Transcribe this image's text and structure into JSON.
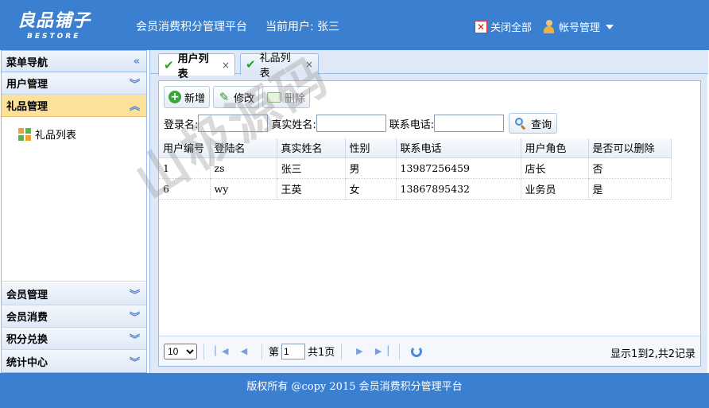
{
  "header": {
    "logo_cn": "良品铺子",
    "logo_en": "BESTORE",
    "title": "会员消费积分管理平台",
    "current_user": "当前用户: 张三",
    "close_all_label": "关闭全部",
    "account_label": "帐号管理"
  },
  "sidebar": {
    "title": "菜单导航",
    "top_sections": [
      "用户管理",
      "礼品管理"
    ],
    "active_section": "礼品管理",
    "active_items": [
      "礼品列表"
    ],
    "bottom_sections": [
      "会员管理",
      "会员消费",
      "积分兑换",
      "统计中心"
    ]
  },
  "tabs": [
    {
      "label": "用户列表",
      "active": true
    },
    {
      "label": "礼品列表",
      "active": false
    }
  ],
  "toolbar": {
    "add_label": "新增",
    "edit_label": "修改",
    "delete_label": "删除"
  },
  "search": {
    "login_label": "登录名:",
    "realname_label": "真实姓名:",
    "phone_label": "联系电话:",
    "query_label": "查询",
    "login_value": "",
    "realname_value": "",
    "phone_value": ""
  },
  "grid": {
    "columns": [
      "用户编号",
      "登陆名",
      "真实姓名",
      "性别",
      "联系电话",
      "用户角色",
      "是否可以删除"
    ],
    "rows": [
      [
        "1",
        "zs",
        "张三",
        "男",
        "13987256459",
        "店长",
        "否"
      ],
      [
        "6",
        "wy",
        "王英",
        "女",
        "13867895432",
        "业务员",
        "是"
      ]
    ]
  },
  "pager": {
    "page_size": "10",
    "page_prefix": "第",
    "page_value": "1",
    "page_suffix": "共1页",
    "info": "显示1到2,共2记录"
  },
  "footer": {
    "text": "版权所有 @copy 2015 会员消费积分管理平台"
  },
  "watermark": "山极源码",
  "colors": {
    "header_bg": "#3a7fd0",
    "active_section_bg": "#fbe199"
  }
}
